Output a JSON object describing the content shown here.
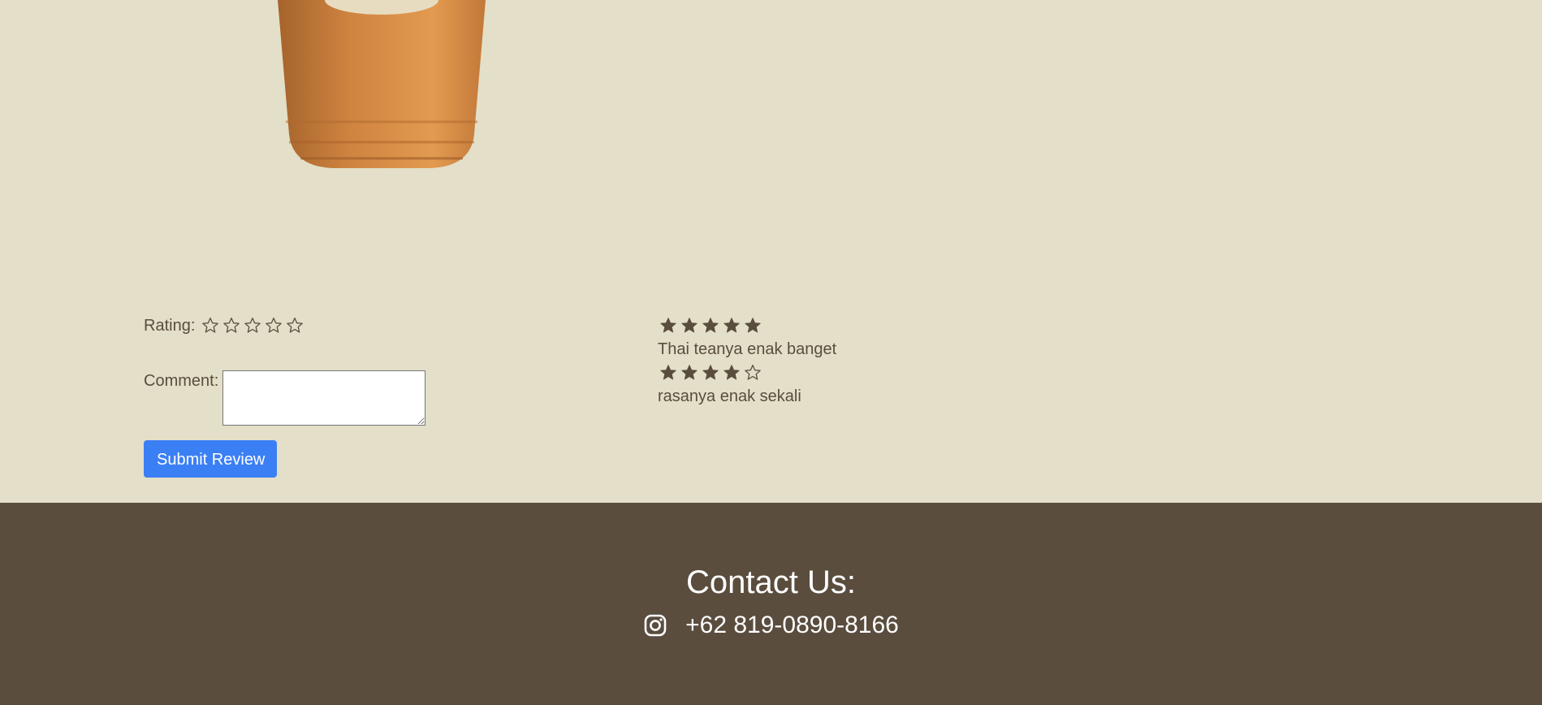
{
  "review_form": {
    "rating_label": "Rating:",
    "comment_label": "Comment:",
    "comment_value": "",
    "submit_label": "Submit Review"
  },
  "reviews": [
    {
      "rating": 5,
      "text": "Thai teanya enak banget"
    },
    {
      "rating": 4,
      "text": "rasanya enak sekali"
    }
  ],
  "footer": {
    "title": "Contact Us:",
    "phone": "+62 819-0890-8166",
    "icon": "instagram-icon"
  },
  "colors": {
    "background": "#e3dfc8",
    "text": "#5a4d3e",
    "footer_bg": "#5a4d3e",
    "button": "#3b7ff5"
  }
}
